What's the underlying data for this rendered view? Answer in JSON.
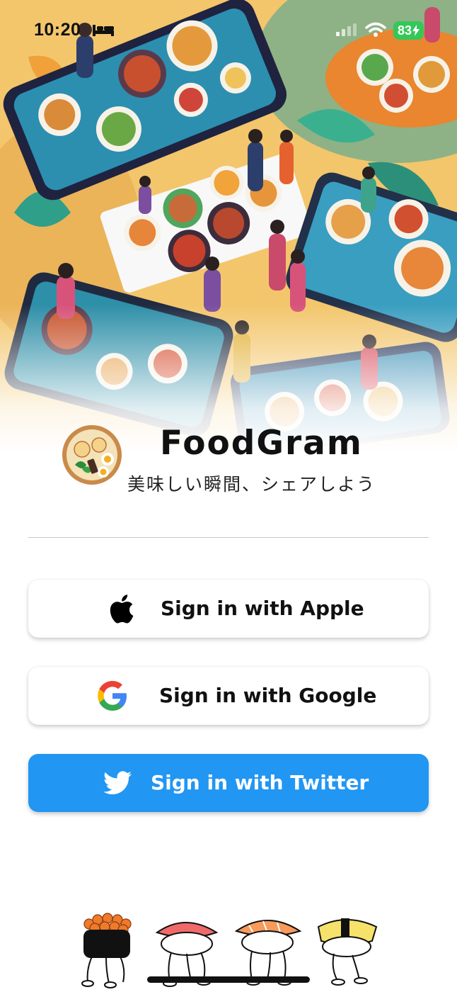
{
  "status_bar": {
    "time": "10:20",
    "battery": "83",
    "icons": [
      "bed-icon",
      "cellular-signal-icon",
      "wifi-icon",
      "battery-charging-icon"
    ]
  },
  "hero": {
    "image": "food-sharing-illustration"
  },
  "brand": {
    "logo": "ramen-bowl-logo",
    "title": "FoodGram",
    "tagline": "美味しい瞬間、シェアしよう"
  },
  "auth": {
    "apple_label": "Sign in with Apple",
    "google_label": "Sign in with Google",
    "twitter_label": "Sign in with Twitter"
  },
  "mascots": [
    "ikura-sushi-icon",
    "tuna-sushi-icon",
    "salmon-sushi-icon",
    "tamago-sushi-icon"
  ],
  "colors": {
    "twitter_blue": "#2196f3",
    "battery_green": "#34c759",
    "hero_background": "#f2c56a"
  }
}
